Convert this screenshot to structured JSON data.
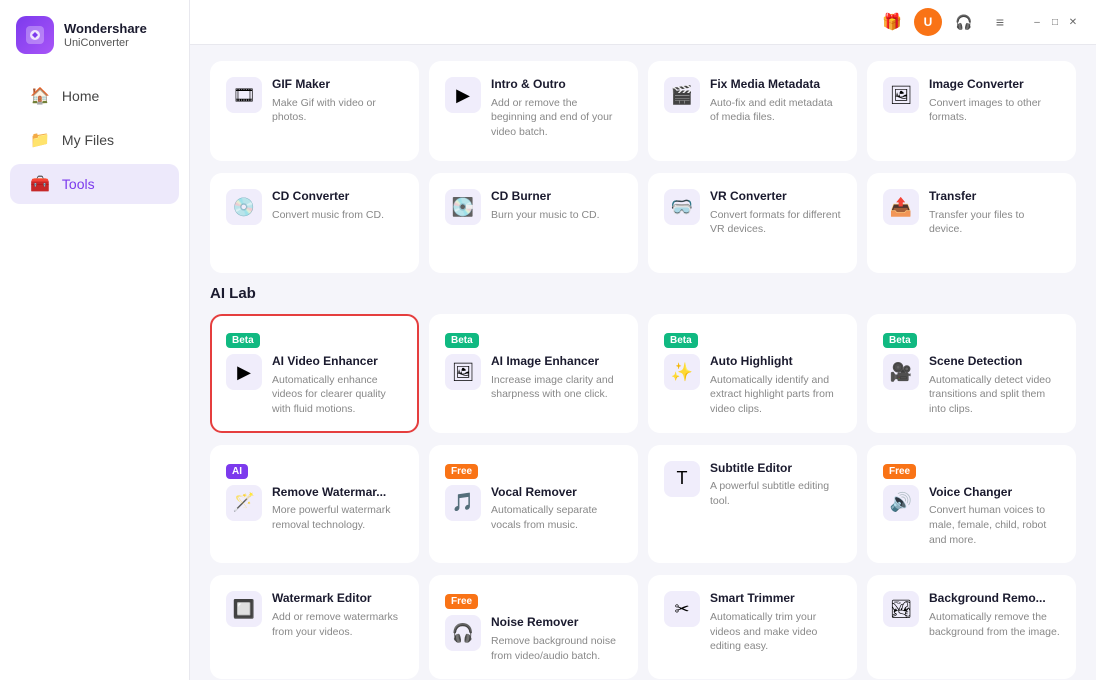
{
  "app": {
    "logo_initials": "U",
    "logo_name": "Wondershare",
    "logo_sub": "UniConverter"
  },
  "sidebar": {
    "nav_items": [
      {
        "id": "home",
        "label": "Home",
        "icon": "🏠",
        "active": false
      },
      {
        "id": "myfiles",
        "label": "My Files",
        "icon": "📁",
        "active": false
      },
      {
        "id": "tools",
        "label": "Tools",
        "icon": "🧰",
        "active": true
      }
    ]
  },
  "titlebar": {
    "gift_icon": "🎁",
    "avatar_label": "U",
    "headset_icon": "🎧",
    "menu_icon": "≡",
    "minimize_icon": "–",
    "maximize_icon": "□",
    "close_icon": "✕"
  },
  "top_section": {
    "tools": [
      {
        "title": "GIF Maker",
        "desc": "Make Gif with video or photos.",
        "icon": "🎞",
        "badge": null
      },
      {
        "title": "Intro & Outro",
        "desc": "Add or remove the beginning and end of your video batch.",
        "icon": "▶",
        "badge": null
      },
      {
        "title": "Fix Media Metadata",
        "desc": "Auto-fix and edit metadata of media files.",
        "icon": "🎬",
        "badge": null
      },
      {
        "title": "Image Converter",
        "desc": "Convert images to other formats.",
        "icon": "🖼",
        "badge": null
      }
    ]
  },
  "middle_section": {
    "tools": [
      {
        "title": "CD Converter",
        "desc": "Convert music from CD.",
        "icon": "💿",
        "badge": null
      },
      {
        "title": "CD Burner",
        "desc": "Burn your music to CD.",
        "icon": "💽",
        "badge": null
      },
      {
        "title": "VR Converter",
        "desc": "Convert formats for different VR devices.",
        "icon": "🥽",
        "badge": null
      },
      {
        "title": "Transfer",
        "desc": "Transfer your files to device.",
        "icon": "📤",
        "badge": null
      }
    ]
  },
  "ai_section": {
    "label": "AI Lab",
    "row1": [
      {
        "title": "AI Video Enhancer",
        "desc": "Automatically enhance videos for clearer quality with fluid motions.",
        "icon": "▶",
        "badge": "Beta",
        "badge_type": "beta",
        "highlighted": true
      },
      {
        "title": "AI Image Enhancer",
        "desc": "Increase image clarity and sharpness with one click.",
        "icon": "🖼",
        "badge": "Beta",
        "badge_type": "beta",
        "highlighted": false
      },
      {
        "title": "Auto Highlight",
        "desc": "Automatically identify and extract highlight parts from video clips.",
        "icon": "✨",
        "badge": "Beta",
        "badge_type": "beta",
        "highlighted": false
      },
      {
        "title": "Scene Detection",
        "desc": "Automatically detect video transitions and split them into clips.",
        "icon": "🎥",
        "badge": "Beta",
        "badge_type": "beta",
        "highlighted": false
      }
    ],
    "row2": [
      {
        "title": "Remove Watermar...",
        "desc": "More powerful watermark removal technology.",
        "icon": "🪄",
        "badge": "AI",
        "badge_type": "ai",
        "highlighted": false
      },
      {
        "title": "Vocal Remover",
        "desc": "Automatically separate vocals from music.",
        "icon": "🎵",
        "badge": "Free",
        "badge_type": "free",
        "highlighted": false
      },
      {
        "title": "Subtitle Editor",
        "desc": "A powerful subtitle editing tool.",
        "icon": "T",
        "badge": null,
        "highlighted": false
      },
      {
        "title": "Voice Changer",
        "desc": "Convert human voices to male, female, child, robot and more.",
        "icon": "🔊",
        "badge": "Free",
        "badge_type": "free",
        "highlighted": false
      }
    ],
    "row3": [
      {
        "title": "Watermark Editor",
        "desc": "Add or remove watermarks from your videos.",
        "icon": "🔲",
        "badge": null,
        "highlighted": false
      },
      {
        "title": "Noise Remover",
        "desc": "Remove background noise from video/audio batch.",
        "icon": "🎧",
        "badge": "Free",
        "badge_type": "free",
        "highlighted": false
      },
      {
        "title": "Smart Trimmer",
        "desc": "Automatically trim your videos and make video editing easy.",
        "icon": "✂",
        "badge": null,
        "highlighted": false
      },
      {
        "title": "Background Remo...",
        "desc": "Automatically remove the background from the image.",
        "icon": "🏞",
        "badge": null,
        "highlighted": false
      }
    ]
  }
}
